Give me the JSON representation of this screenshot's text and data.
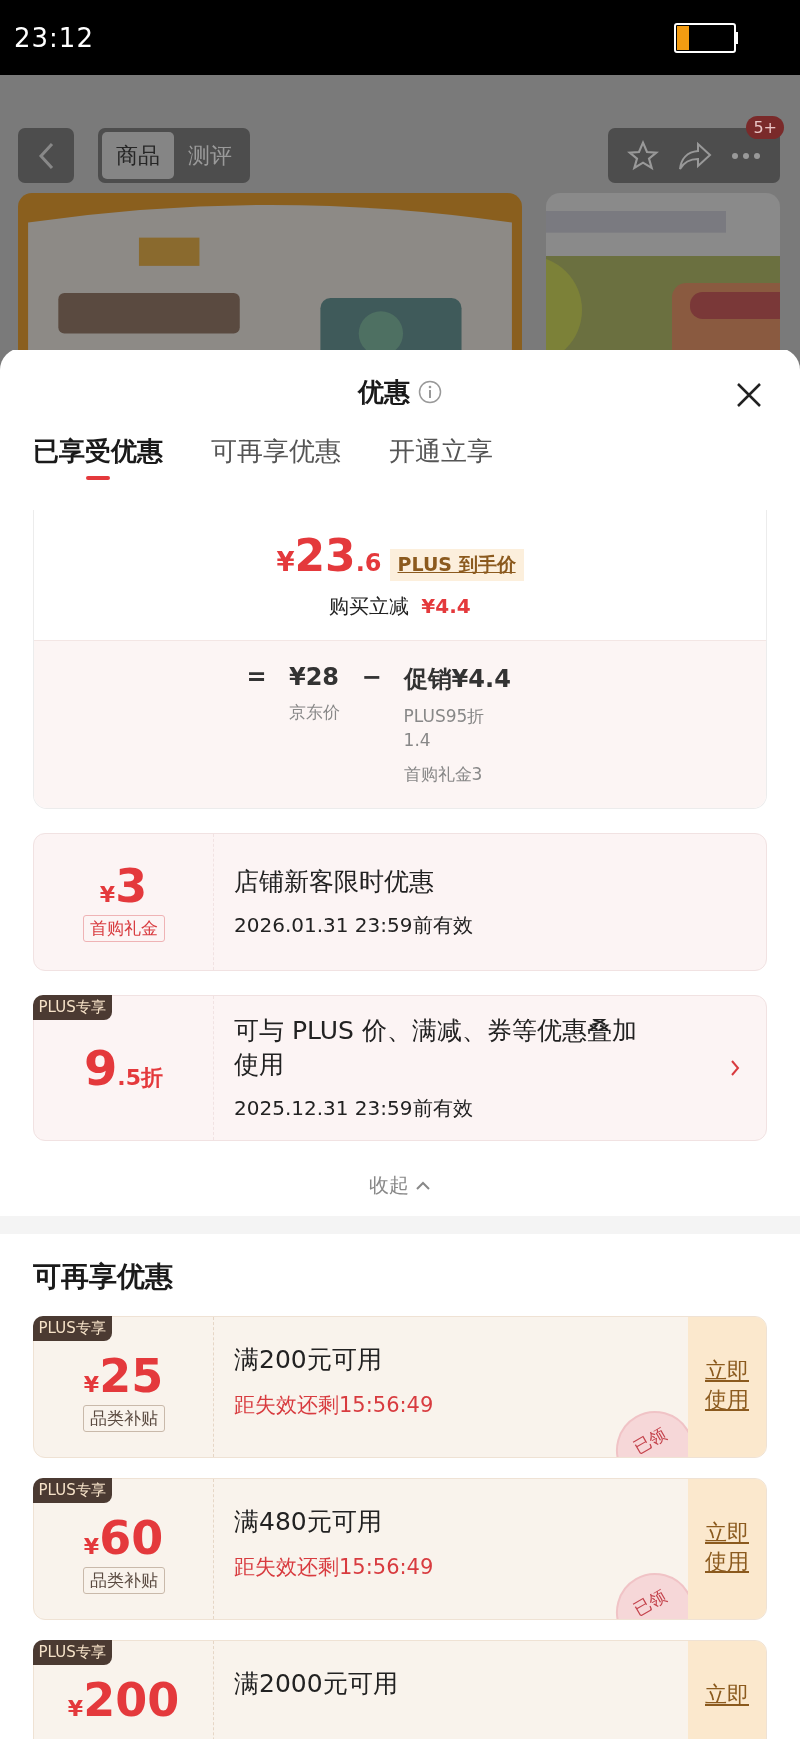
{
  "status_bar": {
    "time": "23:12"
  },
  "product_header": {
    "tabs": [
      {
        "label": "商品",
        "selected": true
      },
      {
        "label": "测评",
        "selected": false
      }
    ],
    "badge": "5+"
  },
  "sheet": {
    "title": "优惠",
    "tabs": [
      {
        "label": "已享受优惠",
        "selected": true
      },
      {
        "label": "可再享优惠",
        "selected": false
      },
      {
        "label": "开通立享",
        "selected": false
      }
    ],
    "price_breakdown": {
      "currency": "¥",
      "price_int": "23",
      "price_dec": ".6",
      "tag": "PLUS 到手价",
      "reduction_label": "购买立减",
      "reduction": "¥4.4",
      "equals": "=",
      "jd_price": "¥28",
      "jd_label": "京东价",
      "minus": "−",
      "promo": "促销¥4.4",
      "promo_details": [
        "PLUS95折 1.4",
        "首购礼金3"
      ]
    },
    "enjoyed": [
      {
        "kind": "cash",
        "currency": "¥",
        "amount": "3",
        "tag": "首购礼金",
        "title": "店铺新客限时优惠",
        "validity": "2026.01.31 23:59前有效"
      },
      {
        "kind": "discount",
        "badge": "PLUS专享",
        "amount": "9",
        "amount_suffix": ".5折",
        "title": "可与 PLUS 价、满减、券等优惠叠加使用",
        "validity": "2025.12.31 23:59前有效"
      }
    ],
    "collapse": "收起",
    "more_title": "可再享优惠",
    "coupons": [
      {
        "badge": "PLUS专享",
        "currency": "¥",
        "amount": "25",
        "tag": "品类补贴",
        "condition": "满200元可用",
        "countdown": "距失效还剩15:56:49",
        "stamp": "已领",
        "action": "立即使用"
      },
      {
        "badge": "PLUS专享",
        "currency": "¥",
        "amount": "60",
        "tag": "品类补贴",
        "condition": "满480元可用",
        "countdown": "距失效还剩15:56:49",
        "stamp": "已领",
        "action": "立即使用"
      },
      {
        "badge": "PLUS专享",
        "currency": "¥",
        "amount": "200",
        "condition": "满2000元可用",
        "action": "立即"
      }
    ]
  }
}
